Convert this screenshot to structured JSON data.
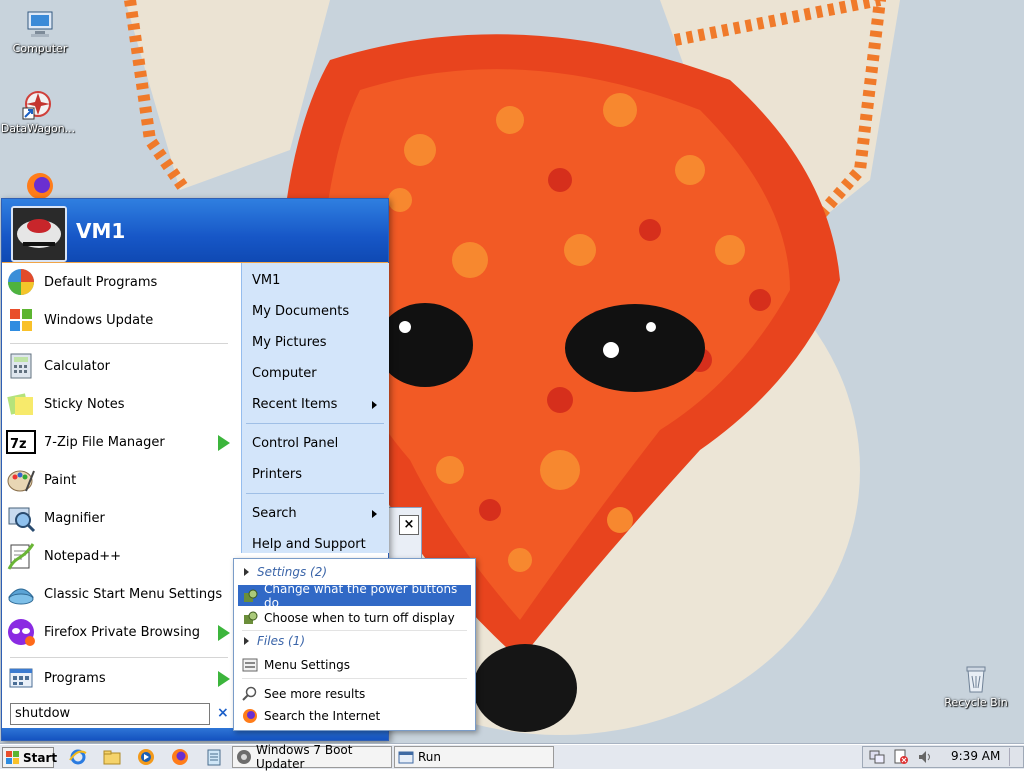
{
  "desktop": {
    "icons": [
      {
        "label": "Computer",
        "icon": "computer-icon"
      },
      {
        "label": "DataWagon...",
        "icon": "datawagon-icon"
      },
      {
        "label": "Recycle Bin",
        "icon": "recycle-bin-icon"
      }
    ]
  },
  "start_menu": {
    "user": "VM1",
    "left_items": [
      {
        "label": "Default Programs",
        "icon": "default-programs-icon"
      },
      {
        "label": "Windows Update",
        "icon": "windows-update-icon"
      },
      {
        "label": "Calculator",
        "icon": "calculator-icon"
      },
      {
        "label": "Sticky Notes",
        "icon": "sticky-notes-icon"
      },
      {
        "label": "7-Zip File Manager",
        "icon": "7zip-icon",
        "submenu": true
      },
      {
        "label": "Paint",
        "icon": "paint-icon"
      },
      {
        "label": "Magnifier",
        "icon": "magnifier-icon"
      },
      {
        "label": "Notepad++",
        "icon": "notepadpp-icon"
      },
      {
        "label": "Classic Start Menu Settings",
        "icon": "classic-shell-icon"
      },
      {
        "label": "Firefox Private Browsing",
        "icon": "firefox-private-icon",
        "submenu": true
      }
    ],
    "programs": {
      "label": "Programs",
      "icon": "programs-icon",
      "submenu": true
    },
    "right_items": [
      {
        "label": "VM1"
      },
      {
        "label": "My Documents"
      },
      {
        "label": "My Pictures"
      },
      {
        "label": "Computer"
      },
      {
        "label": "Recent Items",
        "submenu": true
      },
      {
        "label": "Control Panel"
      },
      {
        "label": "Printers"
      },
      {
        "label": "Search",
        "submenu": true
      },
      {
        "label": "Help and Support"
      }
    ],
    "search": {
      "value": "shutdow",
      "clear": "×"
    }
  },
  "search_results": {
    "groups": [
      {
        "label": "Settings (2)"
      },
      {
        "label": "Files (1)"
      }
    ],
    "items": [
      {
        "label": "Change what the power buttons do",
        "icon": "power-options-icon",
        "selected": true
      },
      {
        "label": "Choose when to turn off display",
        "icon": "power-options-icon"
      },
      {
        "label": "Menu Settings",
        "icon": "menu-settings-icon"
      },
      {
        "label": "See more results",
        "icon": "search-icon"
      },
      {
        "label": "Search the Internet",
        "icon": "firefox-icon"
      }
    ]
  },
  "background_dialog": {
    "close": "×"
  },
  "taskbar": {
    "start_label": "Start",
    "tasks": [
      {
        "label": "Windows 7 Boot Updater",
        "icon": "boot-updater-icon"
      },
      {
        "label": "Run",
        "icon": "run-icon"
      }
    ],
    "clock": "9:39 AM"
  },
  "colors": {
    "menu_blue": "#1757c7",
    "selection": "#3169c6",
    "right_pane": "#d3e5fa",
    "arrow_green": "#3cb53c"
  }
}
